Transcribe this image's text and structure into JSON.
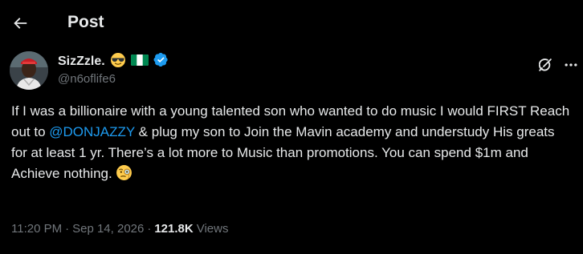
{
  "header": {
    "title": "Post",
    "back_icon": "arrow-left-icon"
  },
  "author": {
    "display_name": "SizZzle.",
    "handle": "@n6oflife6",
    "emojis": [
      "sunglasses-emoji",
      "nigeria-flag-emoji"
    ],
    "verified_icon": "verified-badge-icon",
    "verified_color": "#1d9bf0"
  },
  "actions": {
    "grok_icon": "grok-icon",
    "more_icon": "more-options-icon"
  },
  "tweet": {
    "text_part1": "If I was a billionaire with a young talented son who wanted to do music I would FIRST Reach out to ",
    "mention": "@DONJAZZY",
    "text_part2": " & plug my son to Join the Mavin academy and understudy His greats for at least 1 yr. There’s a lot more to Music than promotions. You can spend $1m and Achieve nothing.",
    "trailing_emoji": "face-with-monocle-emoji"
  },
  "meta": {
    "time": "11:20 PM",
    "separator": "·",
    "date": "Sep 14, 2026",
    "views_count": "121.8K",
    "views_label": "Views"
  },
  "colors": {
    "background": "#000000",
    "text_primary": "#e7e9ea",
    "text_secondary": "#71767b",
    "accent": "#1d9bf0"
  }
}
